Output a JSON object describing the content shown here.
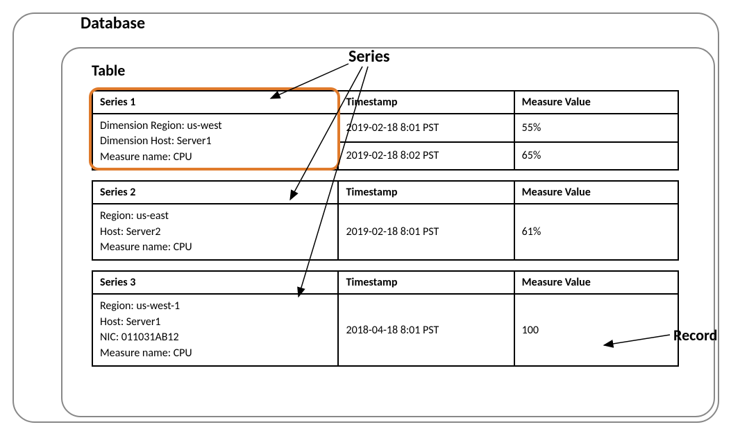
{
  "labels": {
    "database": "Database",
    "table": "Table",
    "series": "Series",
    "record": "Record"
  },
  "headers": {
    "timestamp": "Timestamp",
    "measure": "Measure Value"
  },
  "series1": {
    "name": "Series 1",
    "dim1": "Dimension Region: us-west",
    "dim2": "Dimension Host: Server1",
    "dim3": "Measure name: CPU",
    "row1_ts": "2019-02-18 8:01 PST",
    "row1_val": "55%",
    "row2_ts": "2019-02-18 8:02 PST",
    "row2_val": "65%"
  },
  "series2": {
    "name": "Series 2",
    "dim1": "Region: us-east",
    "dim2": "Host: Server2",
    "dim3": "Measure name: CPU",
    "row1_ts": "2019-02-18 8:01 PST",
    "row1_val": "61%"
  },
  "series3": {
    "name": "Series 3",
    "dim1": "Region: us-west-1",
    "dim2": "Host: Server1",
    "dim3": "NIC: 011031AB12",
    "dim4": "Measure name: CPU",
    "row1_ts": "2018-04-18 8:01 PST",
    "row1_val": "100"
  }
}
